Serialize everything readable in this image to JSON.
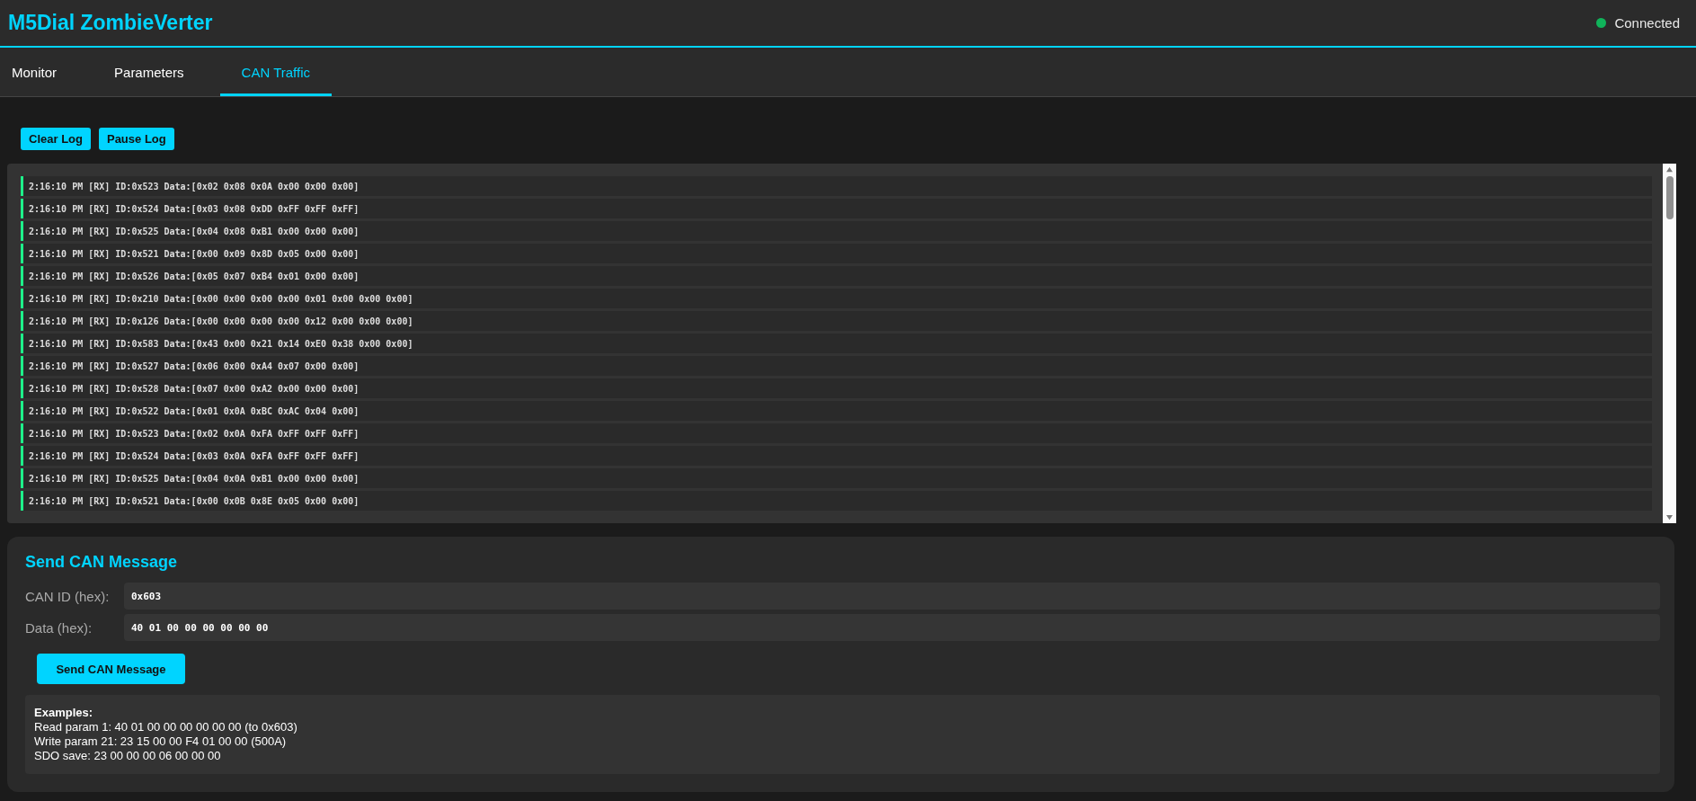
{
  "header": {
    "title": "M5Dial ZombieVerter",
    "status": {
      "label": "Connected",
      "on": true
    }
  },
  "tabs": [
    {
      "label": "Monitor",
      "selected": false
    },
    {
      "label": "Parameters",
      "selected": false
    },
    {
      "label": "CAN Traffic",
      "selected": true
    }
  ],
  "log_controls": [
    "Clear Log",
    "Pause Log"
  ],
  "can_log": [
    "2:16:10 PM [RX] ID:0x523 Data:[0x02 0x08 0x0A 0x00 0x00 0x00]",
    "2:16:10 PM [RX] ID:0x524 Data:[0x03 0x08 0xDD 0xFF 0xFF 0xFF]",
    "2:16:10 PM [RX] ID:0x525 Data:[0x04 0x08 0xB1 0x00 0x00 0x00]",
    "2:16:10 PM [RX] ID:0x521 Data:[0x00 0x09 0x8D 0x05 0x00 0x00]",
    "2:16:10 PM [RX] ID:0x526 Data:[0x05 0x07 0xB4 0x01 0x00 0x00]",
    "2:16:10 PM [RX] ID:0x210 Data:[0x00 0x00 0x00 0x00 0x01 0x00 0x00 0x00]",
    "2:16:10 PM [RX] ID:0x126 Data:[0x00 0x00 0x00 0x00 0x12 0x00 0x00 0x00]",
    "2:16:10 PM [RX] ID:0x583 Data:[0x43 0x00 0x21 0x14 0xE0 0x38 0x00 0x00]",
    "2:16:10 PM [RX] ID:0x527 Data:[0x06 0x00 0xA4 0x07 0x00 0x00]",
    "2:16:10 PM [RX] ID:0x528 Data:[0x07 0x00 0xA2 0x00 0x00 0x00]",
    "2:16:10 PM [RX] ID:0x522 Data:[0x01 0x0A 0xBC 0xAC 0x04 0x00]",
    "2:16:10 PM [RX] ID:0x523 Data:[0x02 0x0A 0xFA 0xFF 0xFF 0xFF]",
    "2:16:10 PM [RX] ID:0x524 Data:[0x03 0x0A 0xFA 0xFF 0xFF 0xFF]",
    "2:16:10 PM [RX] ID:0x525 Data:[0x04 0x0A 0xB1 0x00 0x00 0x00]",
    "2:16:10 PM [RX] ID:0x521 Data:[0x00 0x0B 0x8E 0x05 0x00 0x00]"
  ],
  "send_form": {
    "title": "Send CAN Message",
    "fields": [
      {
        "label": "CAN ID (hex):",
        "value": "0x603"
      },
      {
        "label": "Data (hex):",
        "value": "40 01 00 00 00 00 00 00"
      }
    ],
    "button": "Send CAN Message",
    "examples": {
      "title": "Examples:",
      "lines": [
        "Read param 1: 40 01 00 00 00 00 00 00 (to 0x603)",
        "Write param 21: 23 15 00 00 F4 01 00 00 (500A)",
        "SDO save: 23 00 00 00 06 00 00 00"
      ]
    }
  }
}
